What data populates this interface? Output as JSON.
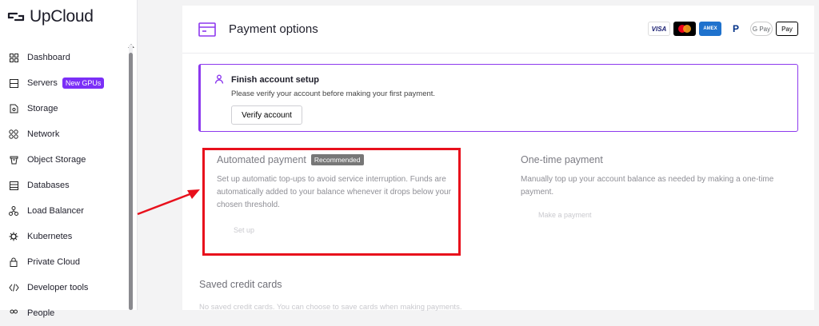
{
  "brand": {
    "name": "UpCloud"
  },
  "sidebar": {
    "items": [
      {
        "label": "Dashboard",
        "icon": "grid-icon"
      },
      {
        "label": "Servers",
        "icon": "server-icon",
        "badge": "New GPUs"
      },
      {
        "label": "Storage",
        "icon": "storage-icon"
      },
      {
        "label": "Network",
        "icon": "network-icon"
      },
      {
        "label": "Object Storage",
        "icon": "bucket-icon"
      },
      {
        "label": "Databases",
        "icon": "database-icon"
      },
      {
        "label": "Load Balancer",
        "icon": "load-balancer-icon"
      },
      {
        "label": "Kubernetes",
        "icon": "kubernetes-icon"
      },
      {
        "label": "Private Cloud",
        "icon": "lock-icon"
      },
      {
        "label": "Developer tools",
        "icon": "code-icon"
      },
      {
        "label": "People",
        "icon": "people-icon"
      }
    ]
  },
  "main": {
    "title": "Payment options",
    "payment_logos": [
      "VISA",
      "Mastercard",
      "AMEX",
      "PayPal",
      "G Pay",
      "Apple Pay"
    ],
    "alert": {
      "title": "Finish account setup",
      "text": "Please verify your account before making your first payment.",
      "button": "Verify account"
    },
    "automated": {
      "title": "Automated payment",
      "badge": "Recommended",
      "description": "Set up automatic top-ups to avoid service interruption. Funds are automatically added to your balance whenever it drops below your chosen threshold.",
      "button": "Set up"
    },
    "onetime": {
      "title": "One-time payment",
      "description": "Manually top up your account balance as needed by making a one-time payment.",
      "button": "Make a payment"
    },
    "saved": {
      "title": "Saved credit cards",
      "text": "No saved credit cards. You can choose to save cards when making payments."
    }
  },
  "colors": {
    "accent": "#8d39ee",
    "highlight": "#e8101c",
    "badge": "#7b2ff7"
  }
}
